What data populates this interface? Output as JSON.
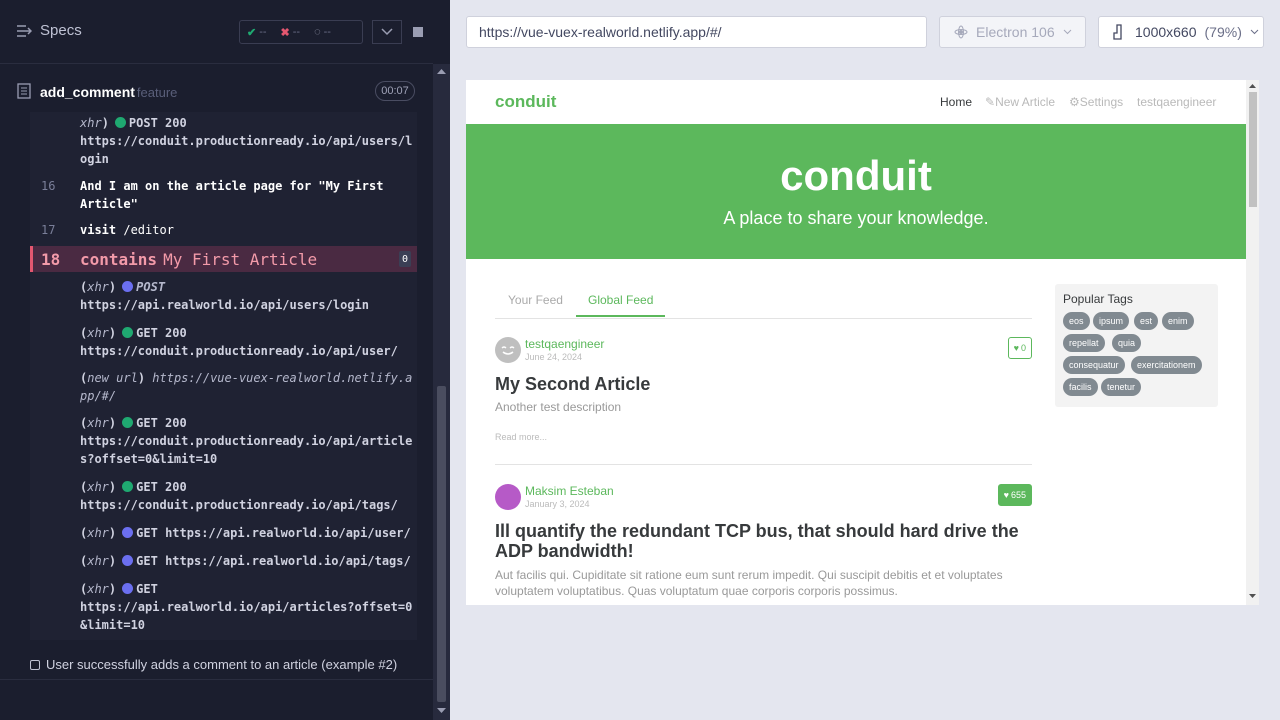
{
  "runner": {
    "specs_label": "Specs",
    "stats": {
      "passed": "--",
      "failed": "--",
      "pending": "--"
    },
    "spec_title": "add_comment",
    "spec_subtitle": "feature",
    "timer": "00:07",
    "next_test": "User successfully adds a comment to an article (example #2)",
    "commands": [
      {
        "num": "",
        "type": "xhr",
        "method": "POST 200",
        "dot": "green",
        "url": "https://conduit.productionready.io/api/users/login"
      },
      {
        "num": "16",
        "text": "And  I am on the article page for \"My First Article\""
      },
      {
        "num": "17",
        "text": "visit",
        "arg": "/editor"
      },
      {
        "num": "18",
        "text": "contains",
        "arg": "My First Article",
        "badge": "0"
      },
      {
        "type": "xhr",
        "method": "POST",
        "dot": "blue",
        "url": "https://api.realworld.io/api/users/login"
      },
      {
        "type": "xhr",
        "method": "GET 200",
        "dot": "green",
        "url": "https://conduit.productionready.io/api/user/"
      },
      {
        "type": "new url",
        "url": "https://vue-vuex-realworld.netlify.app/#/"
      },
      {
        "type": "xhr",
        "method": "GET 200",
        "dot": "green",
        "url": "https://conduit.productionready.io/api/articles?offset=0&limit=10"
      },
      {
        "type": "xhr",
        "method": "GET 200",
        "dot": "green",
        "url": "https://conduit.productionready.io/api/tags/"
      },
      {
        "type": "xhr",
        "method": "GET",
        "dot": "blue",
        "url": "https://api.realworld.io/api/user/"
      },
      {
        "type": "xhr",
        "method": "GET",
        "dot": "blue",
        "url": "https://api.realworld.io/api/tags/"
      },
      {
        "type": "xhr",
        "method": "GET",
        "dot": "blue",
        "url": "https://api.realworld.io/api/articles?offset=0&limit=10"
      }
    ]
  },
  "aut": {
    "url": "https://vue-vuex-realworld.netlify.app/#/",
    "browser": "Electron 106",
    "viewport": "1000x660",
    "zoom": "(79%)"
  },
  "app": {
    "brand": "conduit",
    "nav": [
      "Home",
      "New Article",
      "Settings",
      "testqaengineer"
    ],
    "banner_title": "conduit",
    "banner_tagline": "A place to share your knowledge.",
    "tabs": [
      "Your Feed",
      "Global Feed"
    ],
    "articles": [
      {
        "author": "testqaengineer",
        "date": "June 24, 2024",
        "likes": "0",
        "title": "My Second Article",
        "desc": "Another test description",
        "more": "Read more..."
      },
      {
        "author": "Maksim Esteban",
        "date": "January 3, 2024",
        "likes": "655",
        "title": "Ill quantify the redundant TCP bus, that should hard drive the ADP bandwidth!",
        "desc": "Aut facilis qui. Cupiditate sit ratione eum sunt rerum impedit. Qui suscipit debitis et et voluptates voluptatem voluptatibus. Quas voluptatum quae corporis corporis possimus."
      }
    ],
    "popular_tags_title": "Popular Tags",
    "tags": [
      "eos",
      "ipsum",
      "est",
      "enim",
      "repellat",
      "quia",
      "consequatur",
      "exercitationem",
      "facilis",
      "tenetur"
    ]
  },
  "colors": {
    "accent": "#5cb85c",
    "runner_bg": "#1b1e2e",
    "fail": "#e45770"
  }
}
